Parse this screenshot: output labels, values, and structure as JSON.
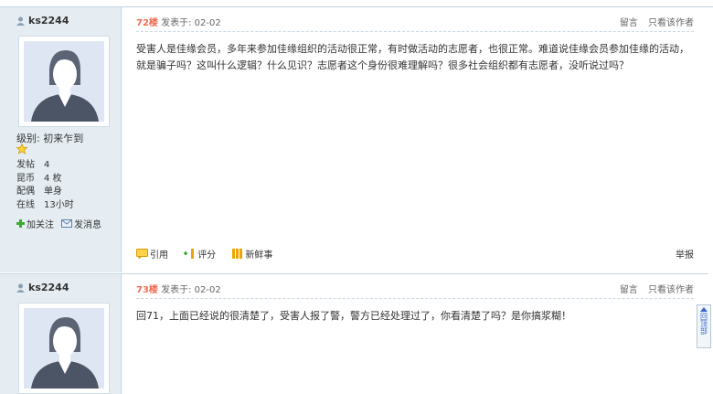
{
  "posts": [
    {
      "username": "ks2244",
      "level_label": "级别: 初来乍到",
      "stats": [
        {
          "key": "发帖",
          "value": "4"
        },
        {
          "key": "昆币",
          "value": "4 枚"
        },
        {
          "key": "配偶",
          "value": "单身"
        },
        {
          "key": "在线",
          "value": "13小时"
        }
      ],
      "follow_label": "加关注",
      "message_label": "发消息",
      "floor": "72楼",
      "posted": "发表于: 02-02",
      "reply_label": "留言",
      "only_author_label": "只看该作者",
      "content": "受害人是佳缘会员，多年来参加佳缘组织的活动很正常，有时做活动的志愿者，也很正常。难道说佳缘会员参加佳缘的活动，就是骗子吗？这叫什么逻辑？什么见识？志愿者这个身份很难理解吗？很多社会组织都有志愿者，没听说过吗？",
      "quote_label": "引用",
      "rate_label": "评分",
      "news_label": "新鲜事",
      "report_label": "举报"
    },
    {
      "username": "ks2244",
      "floor": "73楼",
      "posted": "发表于: 02-02",
      "reply_label": "留言",
      "only_author_label": "只看该作者",
      "content": "回71，上面已经说的很清楚了，受害人报了警，警方已经处理过了，你看清楚了吗？是你搞浆糊！"
    }
  ],
  "back_to_top": "回顶部"
}
